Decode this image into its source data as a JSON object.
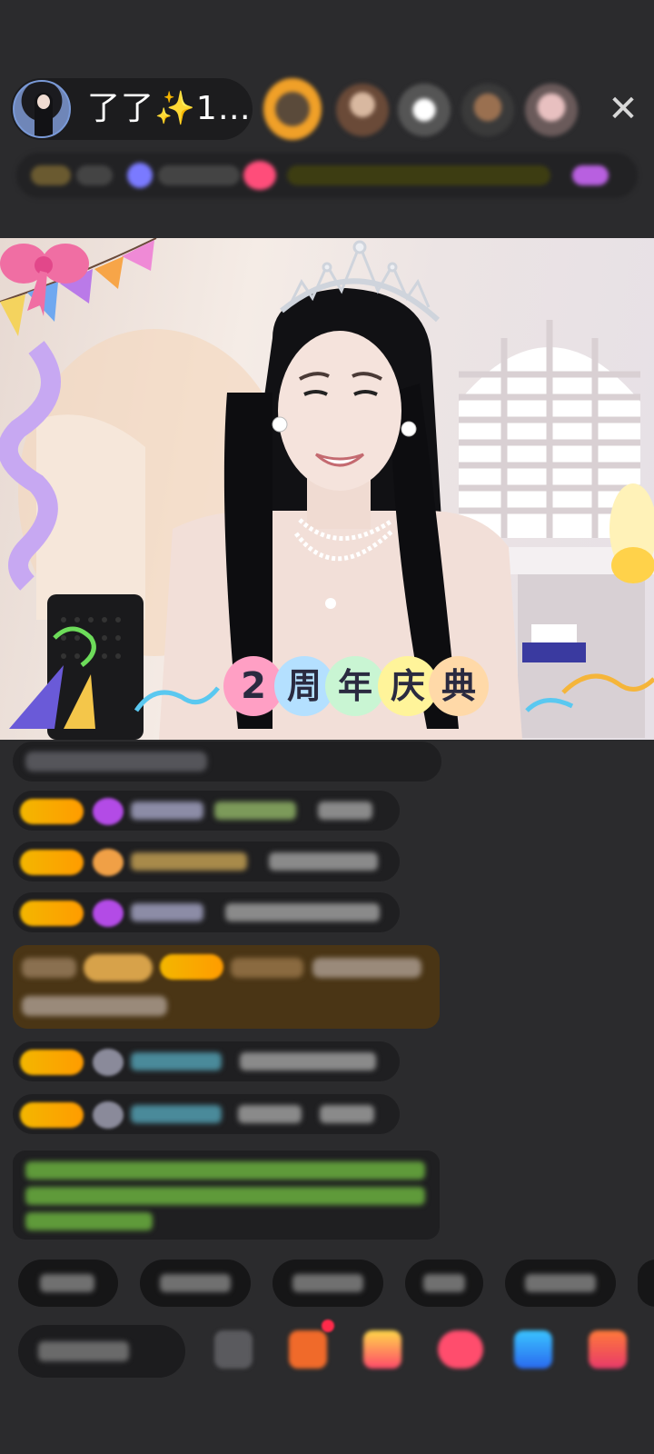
{
  "host": {
    "name": "了了✨1…",
    "avatar_icon": "host-avatar"
  },
  "header": {
    "close_icon": "close-icon",
    "close_glyph": "✕",
    "viewer_avatars": [
      "viewer-avatar-1",
      "viewer-avatar-2",
      "viewer-avatar-3",
      "viewer-avatar-4",
      "viewer-avatar-5"
    ]
  },
  "video": {
    "banner_text": "2周年庆典",
    "banner_chars": [
      "2",
      "周",
      "年",
      "庆",
      "典"
    ]
  },
  "colors": {
    "background": "#2b2b2d",
    "badge_gold": "#f3b600",
    "highlight_row": "#4a3515",
    "long_msg_green": "#79c94a"
  }
}
